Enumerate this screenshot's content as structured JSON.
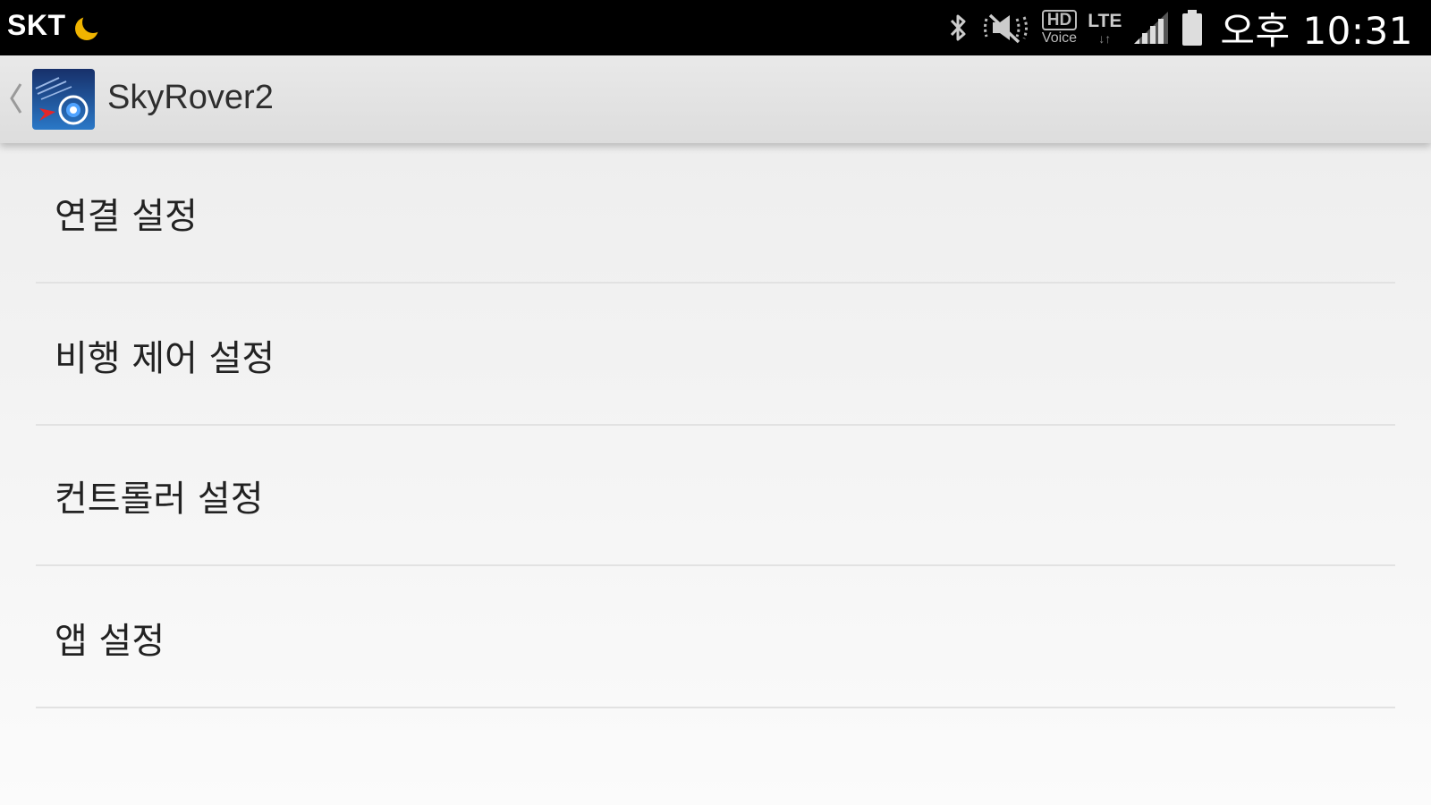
{
  "status_bar": {
    "carrier": "SKT",
    "hd_label": "HD",
    "voice_label": "Voice",
    "network": "LTE",
    "network_arrows": "↓↑",
    "time": "오후 10:31",
    "icons": [
      "moon-icon",
      "bluetooth-icon",
      "mute-icon",
      "hd-voice-icon",
      "lte-icon",
      "signal-icon",
      "battery-icon"
    ]
  },
  "action_bar": {
    "title": "SkyRover2",
    "icons": [
      "back-chevron-icon",
      "app-logo-icon"
    ]
  },
  "settings_menu": {
    "items": [
      {
        "label": "연결 설정"
      },
      {
        "label": "비행 제어 설정"
      },
      {
        "label": "컨트롤러 설정"
      },
      {
        "label": "앱 설정"
      }
    ]
  },
  "colors": {
    "status_bar_bg": "#000000",
    "action_bar_bg": "#e3e3e3",
    "list_bg": "#f3f3f3",
    "divider": "#e2e2e2",
    "moon_accent": "#f0b400",
    "logo_blue": "#1f5fa8"
  }
}
